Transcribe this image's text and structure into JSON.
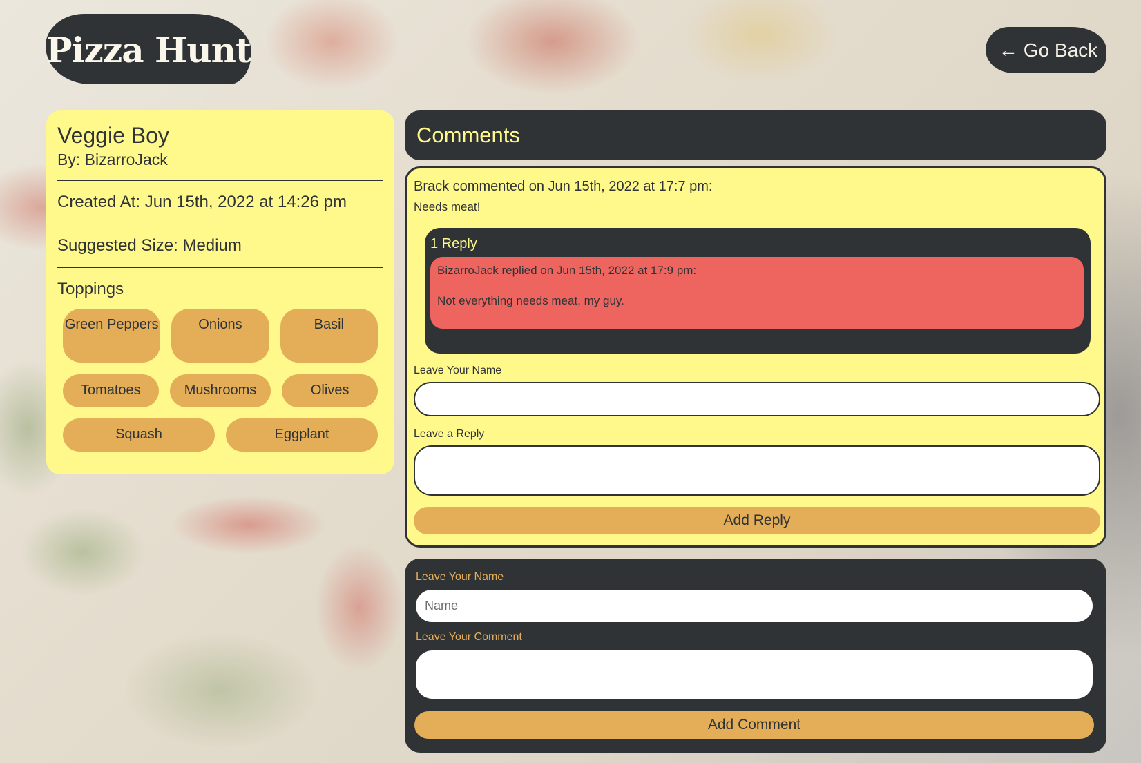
{
  "header": {
    "logo_text": "Pizza Hunt",
    "go_back_arrow": "←",
    "go_back_label": "Go Back"
  },
  "pizza": {
    "name": "Veggie Boy",
    "author": "By: BizarroJack",
    "created_at": "Created At: Jun 15th, 2022 at 14:26 pm",
    "suggested_size": "Suggested Size: Medium",
    "toppings_title": "Toppings",
    "toppings": [
      "Green Peppers",
      "Onions",
      "Basil",
      "Tomatoes",
      "Mushrooms",
      "Olives",
      "Squash",
      "Eggplant"
    ]
  },
  "comments_section": {
    "title": "Comments",
    "comments": [
      {
        "meta": "Brack commented on Jun 15th, 2022 at 17:7 pm:",
        "text": "Needs meat!",
        "replies_count": "1 Reply",
        "replies": [
          {
            "meta": "BizarroJack replied on Jun 15th, 2022 at 17:9 pm:",
            "text": "Not everything needs meat, my guy."
          }
        ],
        "reply_form": {
          "name_label": "Leave Your Name",
          "name_value": "",
          "reply_label": "Leave a Reply",
          "reply_value": "",
          "submit_label": "Add Reply"
        }
      }
    ]
  },
  "new_comment_form": {
    "name_label": "Leave Your Name",
    "name_placeholder": "Name",
    "name_value": "",
    "comment_label": "Leave Your Comment",
    "comment_value": "",
    "submit_label": "Add Comment"
  },
  "colors": {
    "dark": "#2f3336",
    "yellow": "#fff98b",
    "orange": "#e4ae58",
    "red": "#ee6560"
  }
}
